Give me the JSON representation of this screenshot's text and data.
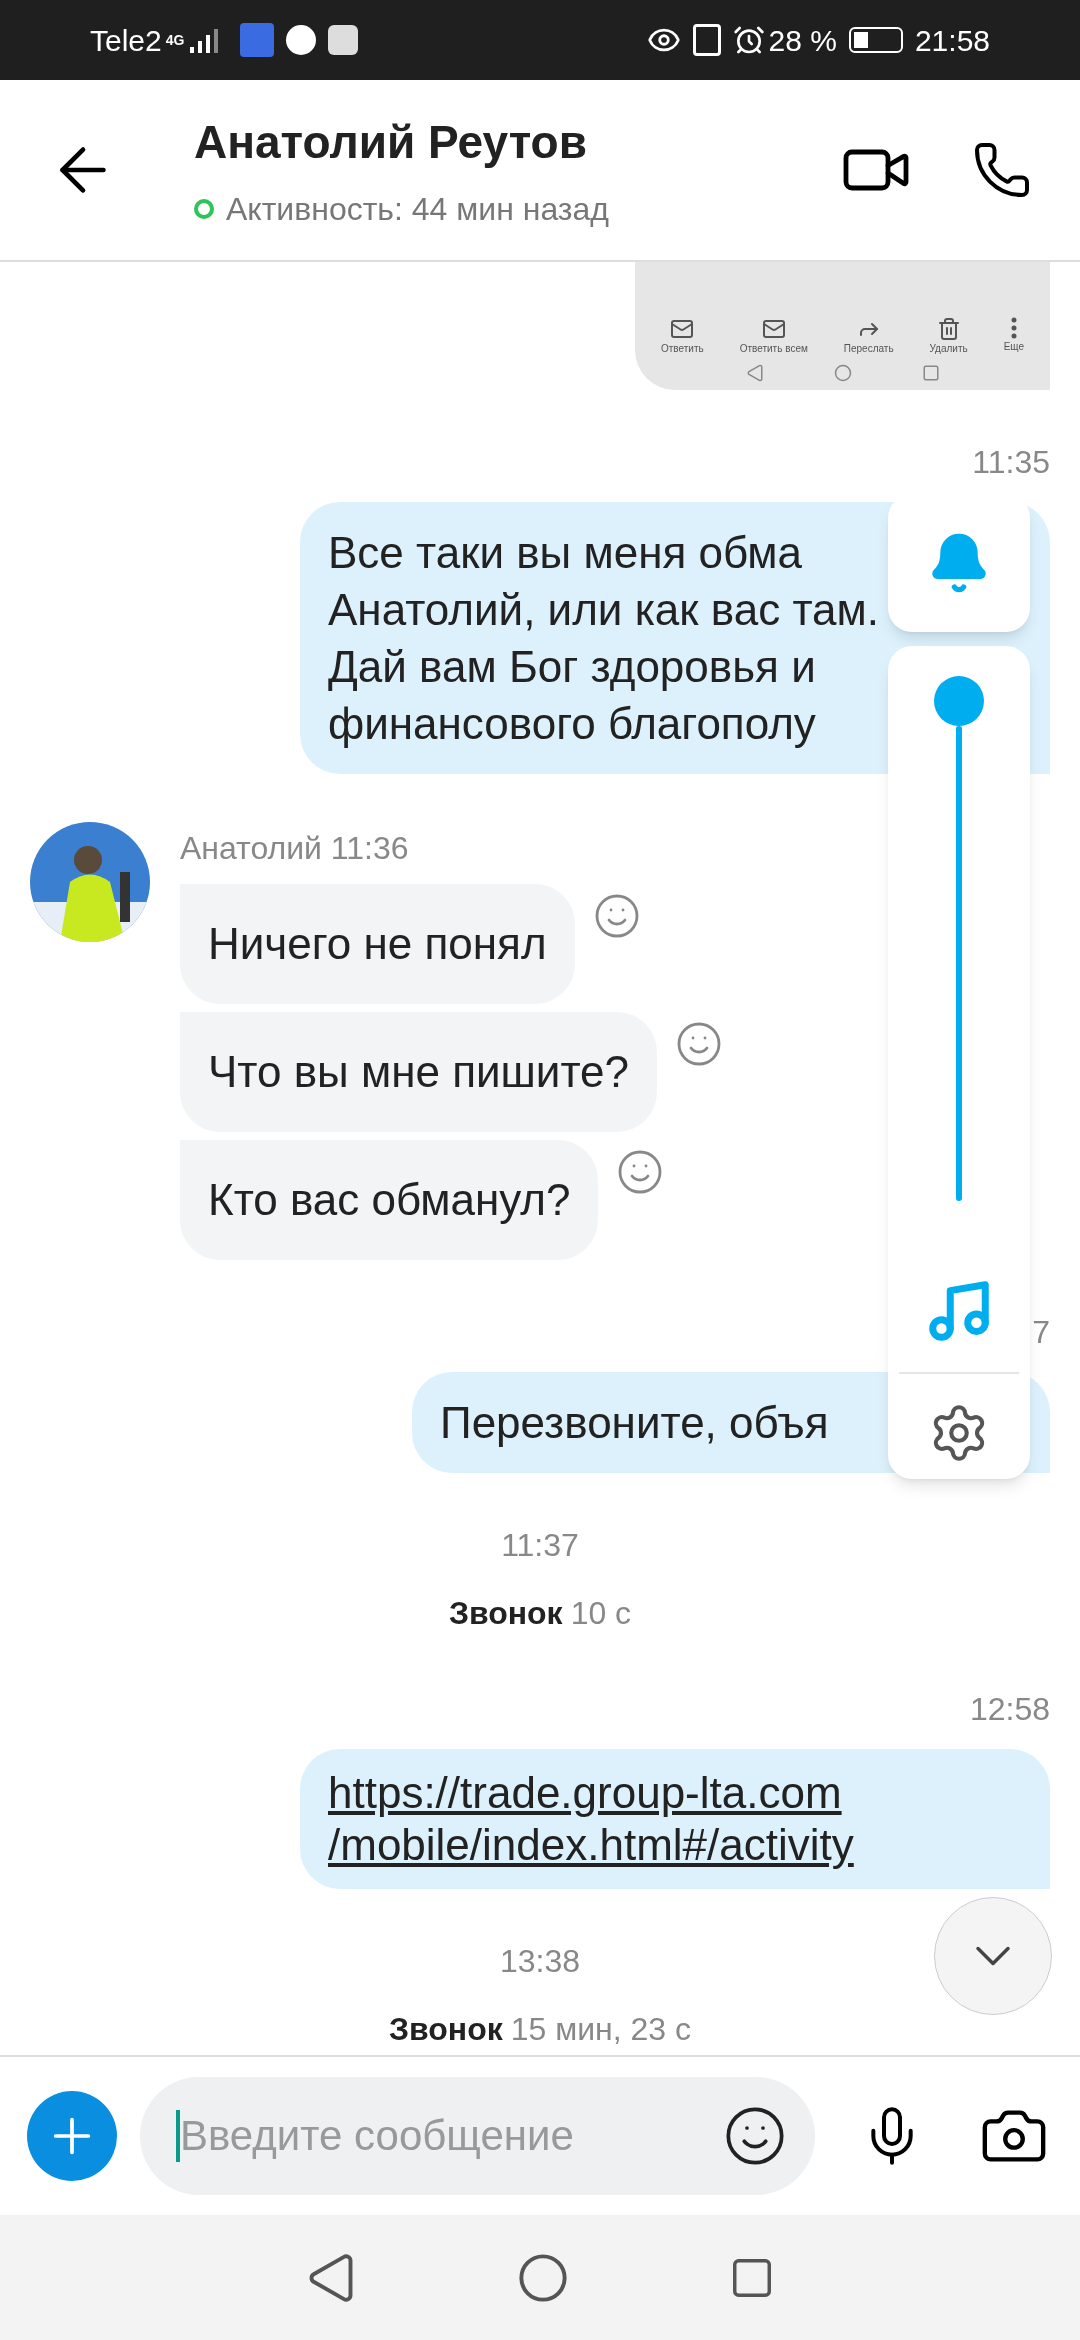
{
  "status_bar": {
    "carrier": "Tele2",
    "network": "4G",
    "battery": "28 %",
    "time": "21:58"
  },
  "header": {
    "title": "Анатолий Реутов",
    "activity": "Активность: 44 мин назад",
    "online": true
  },
  "messages": [
    {
      "kind": "image",
      "toolbar": [
        "Ответить",
        "Ответить всем",
        "Переслать",
        "Удалить",
        "Еще"
      ]
    },
    {
      "kind": "out",
      "time": "11:35",
      "lines": [
        "Все таки вы меня обма",
        "Анатолий, или как вас там.",
        "Дай вам Бог здоровья и",
        "финансового благополу"
      ]
    },
    {
      "kind": "in",
      "sender": "Анатолий 11:36",
      "bubbles": [
        "Ничего не понял",
        "Что вы мне пишите?",
        "Кто вас обманул?"
      ]
    },
    {
      "kind": "out",
      "time": "7",
      "lines": [
        "Перезвоните, объя"
      ]
    },
    {
      "kind": "call",
      "time": "11:37",
      "label": "Звонок",
      "duration": "10 с"
    },
    {
      "kind": "link",
      "time": "12:58",
      "lines": [
        "https://trade.group-lta.com",
        "/mobile/index.html#/activity"
      ]
    },
    {
      "kind": "call",
      "time": "13:38",
      "label": "Звонок",
      "duration": "15 мин, 23 с"
    }
  ],
  "volume_panel": {
    "level": 1.0
  },
  "composer": {
    "placeholder": "Введите сообщение"
  }
}
